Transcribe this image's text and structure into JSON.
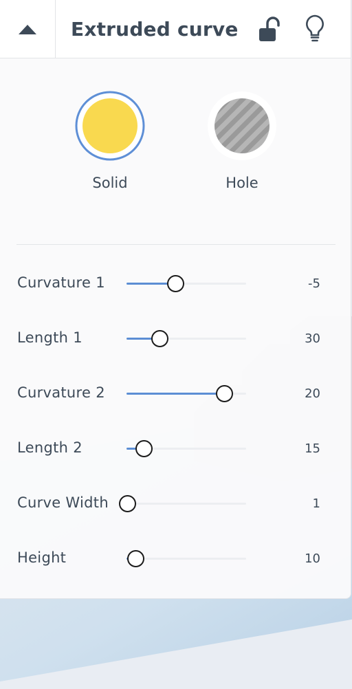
{
  "header": {
    "title": "Extruded curve",
    "collapse_icon": "triangle-up-icon",
    "lock_icon": "unlock-icon",
    "bulb_icon": "lightbulb-icon"
  },
  "modes": [
    {
      "label": "Solid",
      "color": "#f9d94f",
      "selected": true,
      "ring_color": "#5e8fd6"
    },
    {
      "label": "Hole",
      "pattern": "gray-stripes",
      "selected": false
    }
  ],
  "sliders": [
    {
      "label": "Curvature 1",
      "value": "-5",
      "position": 0.4
    },
    {
      "label": "Length 1",
      "value": "30",
      "position": 0.27
    },
    {
      "label": "Curvature 2",
      "value": "20",
      "position": 0.81
    },
    {
      "label": "Length 2",
      "value": "15",
      "position": 0.14
    },
    {
      "label": "Curve Width",
      "value": "1",
      "position": 0.0
    },
    {
      "label": "Height",
      "value": "10",
      "position": 0.07
    }
  ],
  "colors": {
    "accent": "#5e8fd6",
    "text": "#3d4a58",
    "solid": "#f9d94f"
  }
}
